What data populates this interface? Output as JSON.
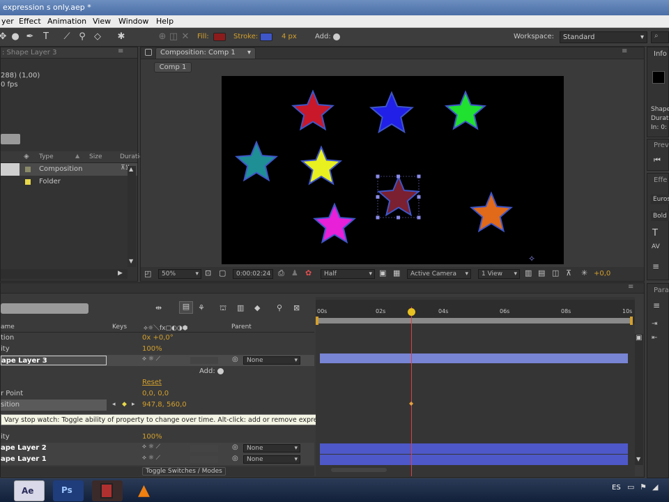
{
  "window": {
    "title": "expression s only.aep *"
  },
  "menu": [
    "yer",
    "Effect",
    "Animation",
    "View",
    "Window",
    "Help"
  ],
  "toolbar": {
    "fill_label": "Fill:",
    "stroke_label": "Stroke:",
    "stroke_width": "4 px",
    "add_label": "Add:",
    "workspace_label": "Workspace:",
    "workspace_value": "Standard",
    "fill_color": "#8c1c1c",
    "stroke_color": "#3e56c8"
  },
  "project": {
    "tab_label": ": Shape Layer 3",
    "info_line1": "288) (1,00)",
    "info_line2": "0 fps",
    "col_type": "Type",
    "col_size": "Size",
    "col_duration": "Duratio",
    "items": [
      {
        "type": "Composition",
        "color": "#8a8a6a"
      },
      {
        "type": "Folder",
        "color": "#e8d84a"
      }
    ]
  },
  "composition": {
    "tab_label": "Composition: Comp 1",
    "sub_tab": "Comp 1",
    "zoom": "50%",
    "timecode": "0:00:02:24",
    "resolution": "Half",
    "camera": "Active Camera",
    "view": "1 View",
    "exposure": "+0,0"
  },
  "right_panel": {
    "info_tab": "Info",
    "line1": "Shape",
    "line2": "Durati",
    "line3": "In: 0:",
    "preview_tab": "Previ",
    "effects_tab": "Effe",
    "font_name": "Euros",
    "font_style": "Bold",
    "para_tab": "Para"
  },
  "timeline": {
    "search_placeholder": "",
    "col_name": "ame",
    "col_keys": "Keys",
    "col_parent": "Parent",
    "ruler": [
      "00s",
      "02s",
      "04s",
      "06s",
      "08s",
      "10s"
    ],
    "rows": [
      {
        "name": "tion",
        "value": "0x +0,0°"
      },
      {
        "name": "ity",
        "value": "100%"
      },
      {
        "name": "ape Layer 3",
        "parent": "None",
        "selected": true
      },
      {
        "name": "",
        "value": "Add:"
      },
      {
        "name": "",
        "value": "Reset"
      },
      {
        "name": "r Point",
        "value": "0,0, 0,0"
      },
      {
        "name": "sition",
        "value": "947,8, 560,0"
      },
      {
        "name": "",
        "value": ""
      },
      {
        "name": "ity",
        "value": "100%"
      },
      {
        "name": "ape Layer 2",
        "parent": "None"
      },
      {
        "name": "ape Layer 1",
        "parent": "None"
      }
    ],
    "tooltip": "Vary stop watch: Toggle ability of property to change over time. Alt-click: add or remove expression.",
    "toggle_label": "Toggle Switches / Modes",
    "current_time_marker": "2.4"
  },
  "stars": [
    {
      "color": "#c8182a"
    },
    {
      "color": "#2020e8"
    },
    {
      "color": "#20e030"
    },
    {
      "color": "#1f8f96"
    },
    {
      "color": "#e8f020"
    },
    {
      "color": "#7a2030"
    },
    {
      "color": "#e820d8"
    },
    {
      "color": "#e06a1a"
    }
  ],
  "taskbar": {
    "items": [
      "Ae",
      "Ps",
      "Film",
      "VLC"
    ],
    "lang": "ES"
  }
}
